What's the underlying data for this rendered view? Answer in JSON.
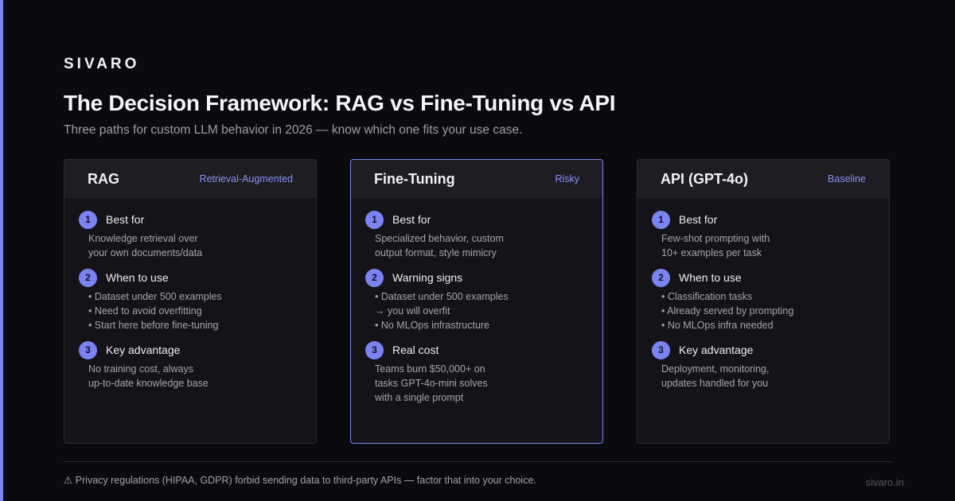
{
  "brand": "SIVARO",
  "title": "The Decision Framework: RAG vs Fine-Tuning vs API",
  "subtitle": "Three paths for custom LLM behavior in 2026 — know which one fits your use case.",
  "colors": {
    "accent": "#7b83f2",
    "background": "#0b0b0f",
    "card": "#141418"
  },
  "cards": [
    {
      "name": "RAG",
      "tag": "Retrieval-Augmented",
      "sections": [
        {
          "num": "1",
          "label": "Best for",
          "lines": [
            "Knowledge retrieval over",
            "your own documents/data"
          ]
        },
        {
          "num": "2",
          "label": "When to use",
          "lines": [
            "• Dataset under 500 examples",
            "• Need to avoid overfitting",
            "• Start here before fine-tuning"
          ]
        },
        {
          "num": "3",
          "label": "Key advantage",
          "lines": [
            "No training cost, always",
            "up-to-date knowledge base"
          ]
        }
      ]
    },
    {
      "name": "Fine-Tuning",
      "tag": "Risky",
      "sections": [
        {
          "num": "1",
          "label": "Best for",
          "lines": [
            "Specialized behavior, custom",
            "output format, style mimicry"
          ]
        },
        {
          "num": "2",
          "label": "Warning signs",
          "lines": [
            "• Dataset under 500 examples",
            "→ you will overfit",
            "• No MLOps infrastructure"
          ]
        },
        {
          "num": "3",
          "label": "Real cost",
          "lines": [
            "Teams burn $50,000+ on",
            "tasks GPT-4o-mini solves",
            "with a single prompt"
          ]
        }
      ]
    },
    {
      "name": "API (GPT-4o)",
      "tag": "Baseline",
      "sections": [
        {
          "num": "1",
          "label": "Best for",
          "lines": [
            "Few-shot prompting with",
            "10+ examples per task"
          ]
        },
        {
          "num": "2",
          "label": "When to use",
          "lines": [
            "• Classification tasks",
            "• Already served by prompting",
            "• No MLOps infra needed"
          ]
        },
        {
          "num": "3",
          "label": "Key advantage",
          "lines": [
            "Deployment, monitoring,",
            "updates handled for you"
          ]
        }
      ]
    }
  ],
  "footnote": "⚠ Privacy regulations (HIPAA, GDPR) forbid sending data to third-party APIs — factor that into your choice.",
  "site": "sivaro.in"
}
